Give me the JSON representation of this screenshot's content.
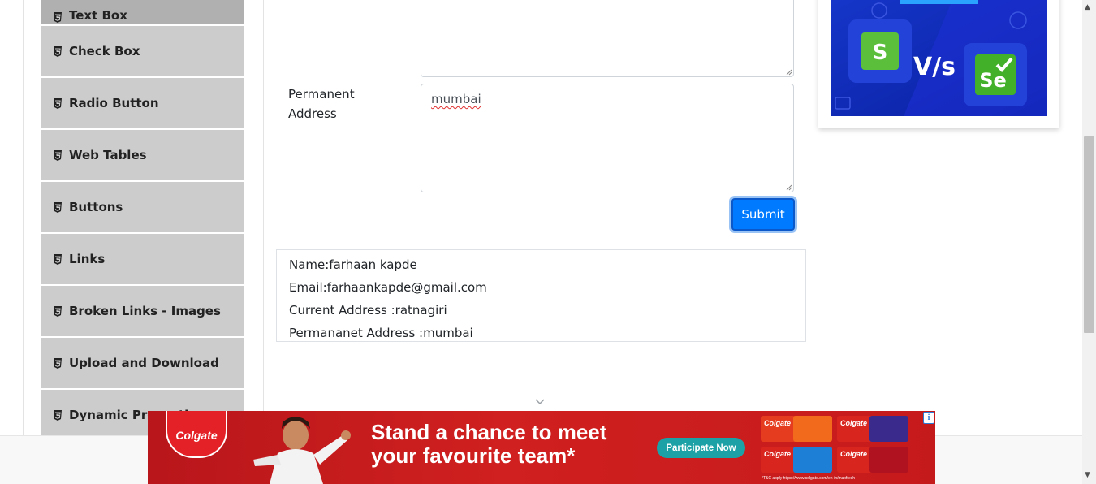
{
  "sidebar": {
    "items": [
      {
        "label": "Text Box",
        "active": true
      },
      {
        "label": "Check Box"
      },
      {
        "label": "Radio Button"
      },
      {
        "label": "Web Tables"
      },
      {
        "label": "Buttons"
      },
      {
        "label": "Links"
      },
      {
        "label": "Broken Links - Images"
      },
      {
        "label": "Upload and Download"
      },
      {
        "label": "Dynamic Properties"
      }
    ]
  },
  "form": {
    "permanent_address_label": "Permanent Address",
    "permanent_address_value": "mumbai",
    "submit_label": "Submit"
  },
  "output": {
    "name": "Name:farhaan kapde",
    "email": "Email:farhaankapde@gmail.com",
    "current_address": "Current Address :ratnagiri",
    "permanent_address": "Permananet Address :mumbai"
  },
  "side_ad": {
    "vs_text": "V/s",
    "se_text": "Se"
  },
  "banner": {
    "brand": "Colgate",
    "headline_line1": "Stand a chance to meet",
    "headline_line2": "your favourite team*",
    "cta": "Participate Now",
    "terms": "*T&C apply https://www.colgate.com/en-in/maxfresh",
    "adchoice_icon": "info-icon"
  },
  "colors": {
    "accent": "#007bff",
    "sidebar_bg": "#cccccc",
    "banner_red": "#c51a1c",
    "cta_teal": "#1ca2a6"
  }
}
